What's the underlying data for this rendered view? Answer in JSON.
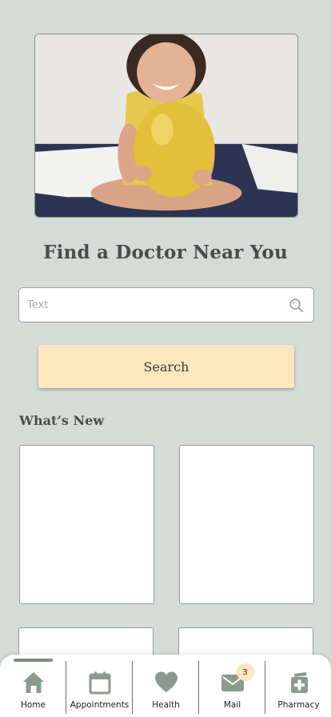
{
  "hero": {
    "image_alt": "Smiling girl sitting cross-legged holding a yellow balloon"
  },
  "header": {
    "title": "Find a Doctor Near You"
  },
  "search": {
    "placeholder": "Text",
    "value": "",
    "icon": "search-icon",
    "button_label": "Search"
  },
  "whats_new": {
    "title": "What’s New",
    "cards": [
      "",
      "",
      "",
      ""
    ]
  },
  "bottom_nav": {
    "active": "Home",
    "items": [
      {
        "label": "Home",
        "icon": "home-icon"
      },
      {
        "label": "Appointments",
        "icon": "calendar-icon"
      },
      {
        "label": "Health",
        "icon": "heart-icon"
      },
      {
        "label": "Mail",
        "icon": "mail-icon",
        "badge": "3"
      },
      {
        "label": "Pharmacy",
        "icon": "pharmacy-icon"
      }
    ]
  },
  "colors": {
    "background": "#d5dcd7",
    "button": "#fbe6bd",
    "nav_icon": "#8a9b8e",
    "active_indicator": "#7b8f80"
  }
}
